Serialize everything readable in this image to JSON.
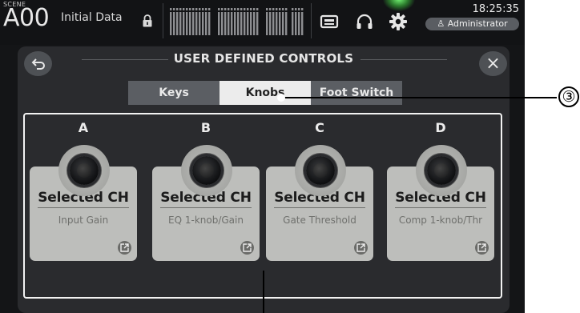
{
  "statusbar": {
    "scene_label": "SCENE",
    "scene_number": "A00",
    "scene_name": "Initial Data",
    "time": "18:25:35",
    "user": "Administrator"
  },
  "panel": {
    "title": "USER DEFINED CONTROLS",
    "tabs": [
      {
        "label": "Keys",
        "active": false
      },
      {
        "label": "Knobs",
        "active": true
      },
      {
        "label": "Foot Switch",
        "active": false
      }
    ],
    "knobs": [
      {
        "letter": "A",
        "title": "Selected CH",
        "parameter": "Input Gain"
      },
      {
        "letter": "B",
        "title": "Selected CH",
        "parameter": "EQ 1-knob/Gain"
      },
      {
        "letter": "C",
        "title": "Selected CH",
        "parameter": "Gate Threshold"
      },
      {
        "letter": "D",
        "title": "Selected CH",
        "parameter": "Comp 1-knob/Thr"
      }
    ]
  },
  "annotation": {
    "callout_number": "③"
  },
  "colors": {
    "background": "#141517",
    "panel": "#2a2b2e",
    "card": "#bdbebb",
    "tab_active": "#ececec",
    "tab_inactive": "#5b5e63",
    "status_led": "#66ff66"
  }
}
